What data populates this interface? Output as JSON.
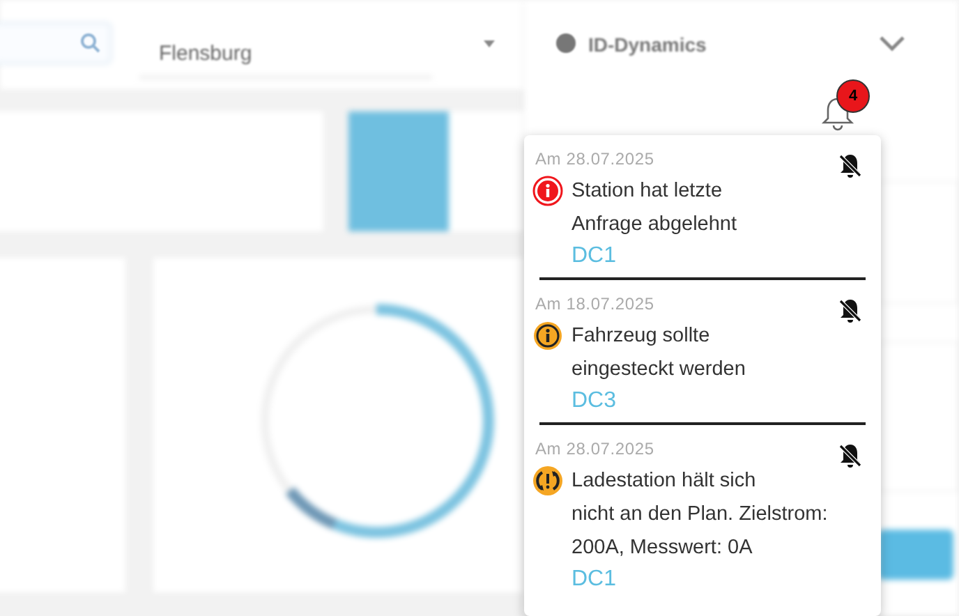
{
  "header": {
    "location": "Flensburg",
    "company": "ID-Dynamics"
  },
  "notifications": {
    "badge": "4",
    "items": [
      {
        "kind": "error",
        "date": "Am 28.07.2025",
        "message": "Station hat letzte\nAnfrage abgelehnt",
        "station": "DC1"
      },
      {
        "kind": "warning",
        "date": "Am 18.07.2025",
        "message": "Fahrzeug sollte\neingesteckt werden",
        "station": "DC3"
      },
      {
        "kind": "schedule",
        "date": "Am 28.07.2025",
        "message": "Ladestation hält sich\nnicht an den Plan. Zielstrom:\n200A, Messwert: 0A",
        "station": "DC1"
      }
    ]
  }
}
